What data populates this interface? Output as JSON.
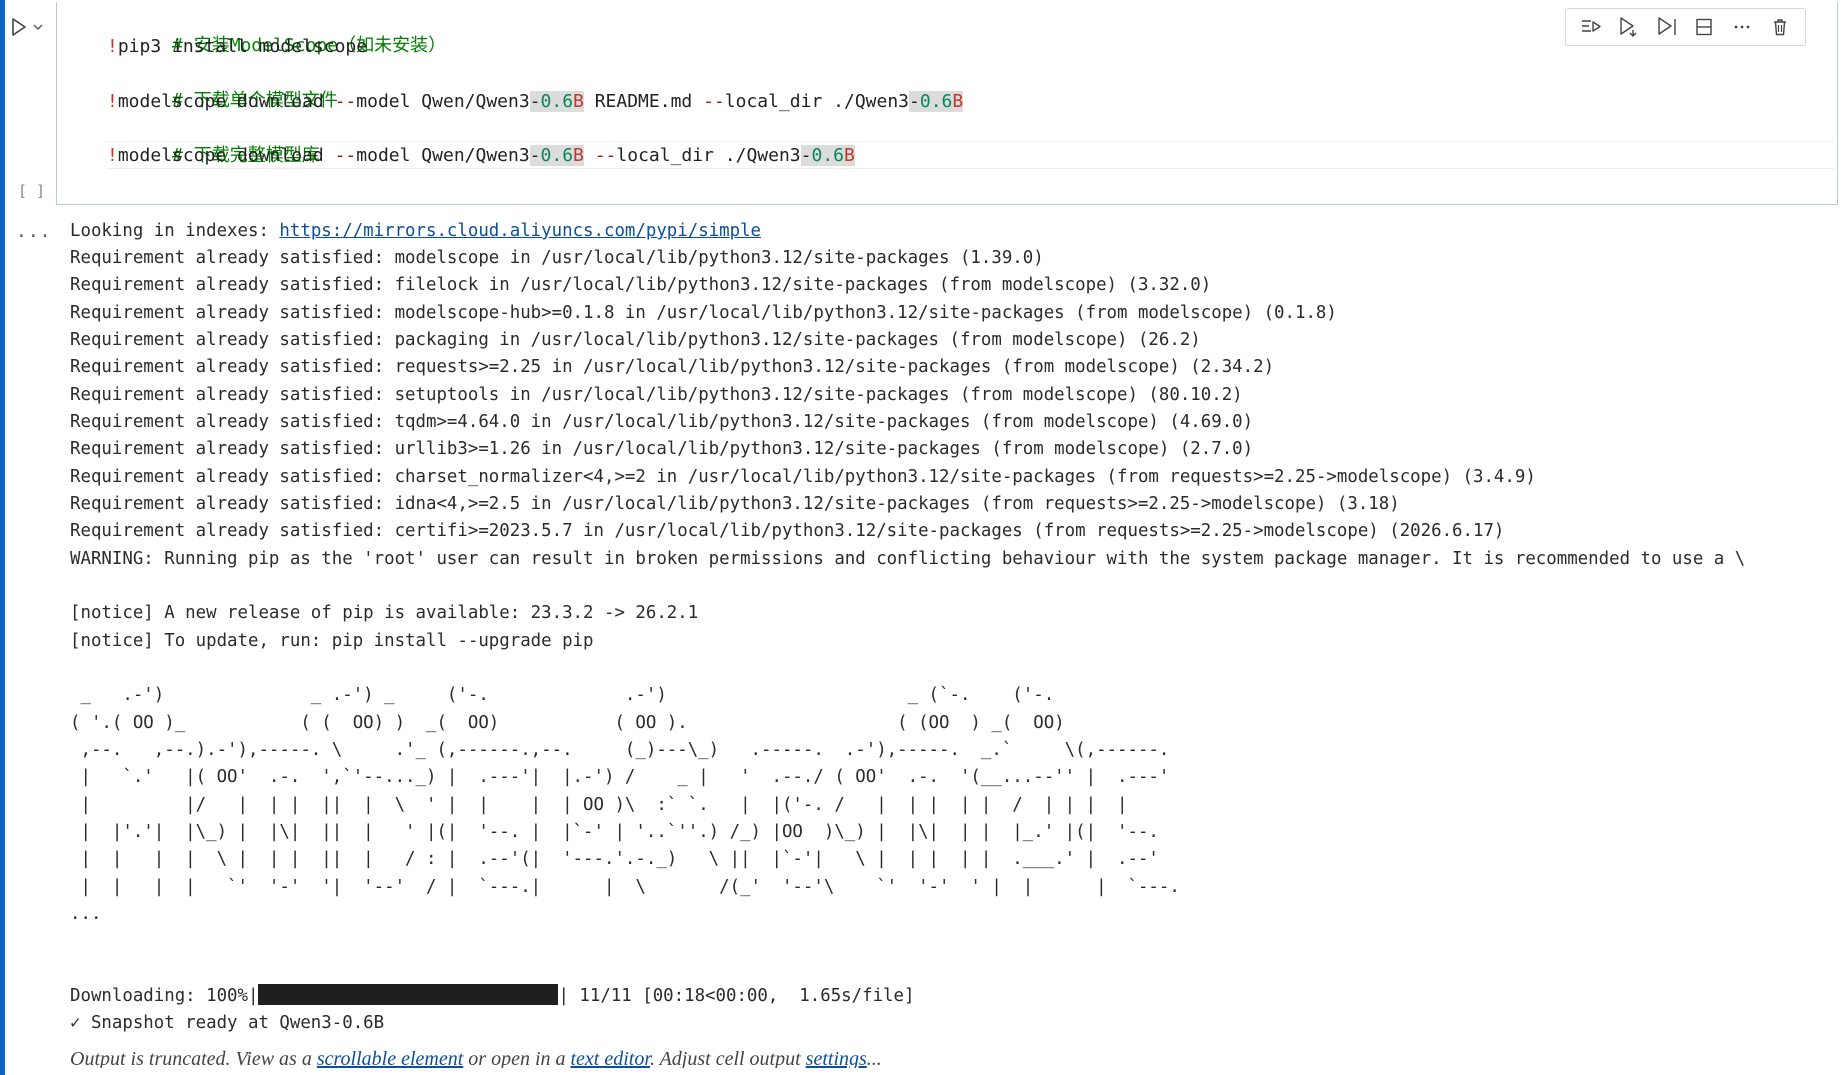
{
  "cell": {
    "execution_count": "[ ]",
    "code": {
      "line1": "# 安装ModelScope（如未安装）",
      "line2_bang": "!",
      "line2_rest": "pip3 install modelscope",
      "line3": "# 下载单个模型文件",
      "line4_bang": "!",
      "line4_a": "modelscope download ",
      "line4_flag1": "--",
      "line4_b": "model Qwen/Qwen3",
      "line4_hl1_dash": "-",
      "line4_hl1_num": "0.6",
      "line4_hl1_b": "B",
      "line4_c": " README.md ",
      "line4_flag2": "--",
      "line4_d": "local_dir ./Qwen3",
      "line4_hl2_dash": "-",
      "line4_hl2_num": "0.6",
      "line4_hl2_b": "B",
      "line5": "# 下载完整模型库",
      "line6_bang": "!",
      "line6_a": "modelscope download ",
      "line6_flag1": "--",
      "line6_b": "model Qwen/Qwen3",
      "line6_hl1_dash": "-",
      "line6_hl1_num": "0.6",
      "line6_hl1_b": "B",
      "line6_c": " ",
      "line6_flag2": "--",
      "line6_d": "local_dir ./Qwen3",
      "line6_hl2_dash": "-",
      "line6_hl2_num": "0.6",
      "line6_hl2_b": "B"
    }
  },
  "toolbar": {
    "icons": [
      "run-above-icon",
      "run-below-icon",
      "run-cell-and-below-icon",
      "split-cell-icon",
      "more-icon",
      "delete-icon"
    ]
  },
  "output": {
    "more_label": "...",
    "looking_prefix": "Looking in indexes: ",
    "looking_url": "https://mirrors.cloud.aliyuncs.com/pypi/simple",
    "lines": [
      "Requirement already satisfied: modelscope in /usr/local/lib/python3.12/site-packages (1.39.0)",
      "Requirement already satisfied: filelock in /usr/local/lib/python3.12/site-packages (from modelscope) (3.32.0)",
      "Requirement already satisfied: modelscope-hub>=0.1.8 in /usr/local/lib/python3.12/site-packages (from modelscope) (0.1.8)",
      "Requirement already satisfied: packaging in /usr/local/lib/python3.12/site-packages (from modelscope) (26.2)",
      "Requirement already satisfied: requests>=2.25 in /usr/local/lib/python3.12/site-packages (from modelscope) (2.34.2)",
      "Requirement already satisfied: setuptools in /usr/local/lib/python3.12/site-packages (from modelscope) (80.10.2)",
      "Requirement already satisfied: tqdm>=4.64.0 in /usr/local/lib/python3.12/site-packages (from modelscope) (4.69.0)",
      "Requirement already satisfied: urllib3>=1.26 in /usr/local/lib/python3.12/site-packages (from modelscope) (2.7.0)",
      "Requirement already satisfied: charset_normalizer<4,>=2 in /usr/local/lib/python3.12/site-packages (from requests>=2.25->modelscope) (3.4.9)",
      "Requirement already satisfied: idna<4,>=2.5 in /usr/local/lib/python3.12/site-packages (from requests>=2.25->modelscope) (3.18)",
      "Requirement already satisfied: certifi>=2023.5.7 in /usr/local/lib/python3.12/site-packages (from requests>=2.25->modelscope) (2026.6.17)",
      "WARNING: Running pip as the 'root' user can result in broken permissions and conflicting behaviour with the system package manager. It is recommended to use a \\"
    ],
    "notice1": "[notice] A new release of pip is available: 23.3.2 -> 26.2.1",
    "notice2": "[notice] To update, run: pip install --upgrade pip",
    "ascii_art": [
      " _   .-')              _ .-') _     ('-.             .-')                       _ (`-.    ('-.",
      "( '.( OO )_           ( (  OO) )  _(  OO)           ( OO ).                    ( (OO  ) _(  OO)",
      " ,--.   ,--.).-'),-----. \\     .'_ (,------.,--.     (_)---\\_)   .-----.  .-'),-----.  _.`     \\(,------.",
      " |   `.'   |( OO'  .-.  ',`'--..._) |  .---'|  |.-') /    _ |   '  .--./ ( OO'  .-.  '(__...--'' |  .---'",
      " |         |/   |  | |  ||  |  \\  ' |  |    |  | OO )\\  :` `.   |  |('-. /   |  | |  | |  /  | | |  |",
      " |  |'.'|  |\\_) |  |\\|  ||  |   ' |(|  '--. |  |`-' | '..`''.) /_) |OO  )\\_) |  |\\|  | |  |_.' |(|  '--.",
      " |  |   |  |  \\ |  | |  ||  |   / : |  .--'(|  '---.'.-._)   \\ ||  |`-'|   \\ |  | |  | |  .___.' |  .--'",
      " |  |   |  |   `'  '-'  '|  '--'  / |  `---.|      |  \\       /(_'  '--'\\    `'  '-'  ' |  |      |  `---.",
      "..."
    ],
    "download_label": "Downloading: 100%|",
    "download_stats": "| 11/11 [00:18<00:00,  1.65s/file]",
    "download_progress": 1.0,
    "snapshot": "✓ Snapshot ready at Qwen3-0.6B",
    "truncated": {
      "prefix": "Output is truncated. View as a ",
      "link1": "scrollable element",
      "mid1": " or open in a ",
      "link2": "text editor",
      "mid2": ". Adjust cell output ",
      "link3": "settings",
      "suffix": "..."
    }
  }
}
